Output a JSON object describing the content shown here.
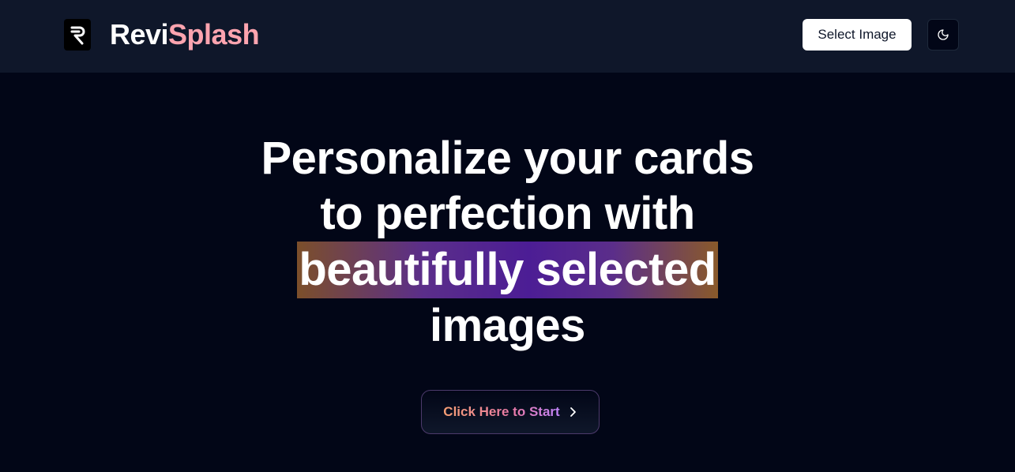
{
  "header": {
    "brand_part1": "Revi",
    "brand_part2": "Splash",
    "select_image_label": "Select Image",
    "logo_icon": "revisplash-logo-icon",
    "theme_icon": "moon-icon"
  },
  "hero": {
    "line1": "Personalize your cards",
    "line2": "to perfection with",
    "line3_highlight": "beautifully selected",
    "line4": "images"
  },
  "cta": {
    "label": "Click Here to Start",
    "icon": "chevron-right-icon"
  },
  "colors": {
    "page_bg": "#020617",
    "navbar_bg": "#0f172a",
    "brand_accent": "#fda4af",
    "highlight_purple": "#4c1d95",
    "highlight_brown": "#7c4f2a"
  }
}
